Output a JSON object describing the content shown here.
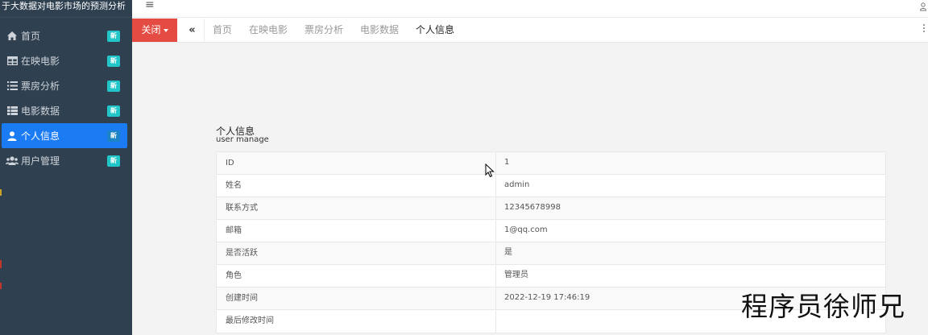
{
  "app": {
    "title": "于大数据对电影市场的预测分析"
  },
  "sidebar": {
    "items": [
      {
        "label": "首页",
        "icon": "home-icon",
        "badge": "新"
      },
      {
        "label": "在映电影",
        "icon": "table-icon",
        "badge": "新"
      },
      {
        "label": "票房分析",
        "icon": "list-icon",
        "badge": "新"
      },
      {
        "label": "电影数据",
        "icon": "th-icon",
        "badge": "新"
      },
      {
        "label": "个人信息",
        "icon": "user-icon",
        "badge": "新",
        "active": true
      },
      {
        "label": "用户管理",
        "icon": "users-icon",
        "badge": "新"
      }
    ]
  },
  "topbar": {
    "menu_icon": "hamburger-icon",
    "close_label": "关闭",
    "back_icon": "double-chevron-left-icon"
  },
  "tabs": [
    {
      "label": "首页"
    },
    {
      "label": "在映电影"
    },
    {
      "label": "票房分析"
    },
    {
      "label": "电影数据"
    },
    {
      "label": "个人信息",
      "active": true
    }
  ],
  "profile": {
    "title": "个人信息",
    "subtitle": "user manage",
    "rows": [
      {
        "key": "ID",
        "value": "1"
      },
      {
        "key": "姓名",
        "value": "admin"
      },
      {
        "key": "联系方式",
        "value": "12345678998"
      },
      {
        "key": "邮箱",
        "value": "1@qq.com"
      },
      {
        "key": "是否活跃",
        "value": "是"
      },
      {
        "key": "角色",
        "value": "管理员"
      },
      {
        "key": "创建时间",
        "value": "2022-12-19 17:46:19"
      },
      {
        "key": "最后修改时间",
        "value": ""
      }
    ]
  },
  "watermark": "程序员徐师兄",
  "colors": {
    "sidebar_bg": "#2f4050",
    "active_item": "#1a7bf2",
    "badge": "#23c6c8",
    "close_button": "#e34b43"
  }
}
